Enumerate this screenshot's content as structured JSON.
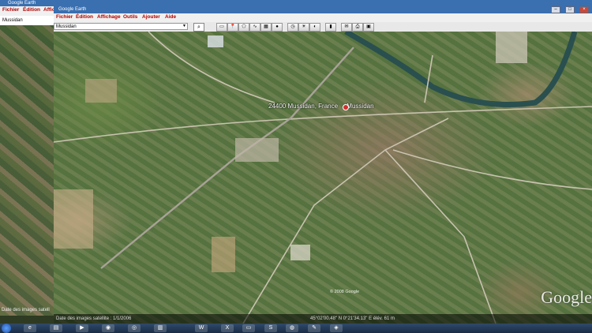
{
  "back_window": {
    "title": "Google Earth",
    "menu": [
      "Fichier",
      "Édition",
      "Affich"
    ],
    "search_value": "Mussidan",
    "credit": "Date des images satell"
  },
  "front_window": {
    "title": "Google Earth",
    "menu": [
      "Fichier",
      "Édition",
      "Affichage",
      "Outils",
      "Ajouter",
      "Aide"
    ],
    "search_value": "Mussidan",
    "toolbar_icons": [
      "search-icon",
      "hide-sidebar-icon",
      "placemark-icon",
      "polygon-icon",
      "path-icon",
      "overlay-icon",
      "tour-icon",
      "history-icon",
      "sun-icon",
      "planets-icon",
      "ruler-icon",
      "email-icon",
      "print-icon",
      "maps-icon"
    ],
    "place_label": "24400 Mussidan, France",
    "pin_label": "Mussidan",
    "copyright": "© 2008 Google",
    "status_left": "Date des images satellite : 1/1/2006",
    "status_right": "45°02'00.48\" N   0°21'34.13\" E   élév. 61 m",
    "logo": "Google"
  },
  "taskbar": {
    "items": [
      "start-orb",
      "ie-icon",
      "explorer-icon",
      "media-icon",
      "firefox-icon",
      "app-icon",
      "explorer2-icon",
      "word-icon",
      "excel-icon",
      "skype-icon",
      "earth-icon",
      "paint-icon",
      "app2-icon"
    ]
  },
  "colors": {
    "title_bar": "#3a6fb0",
    "menu_text": "#b00000",
    "taskbar": "#1a2c44"
  }
}
